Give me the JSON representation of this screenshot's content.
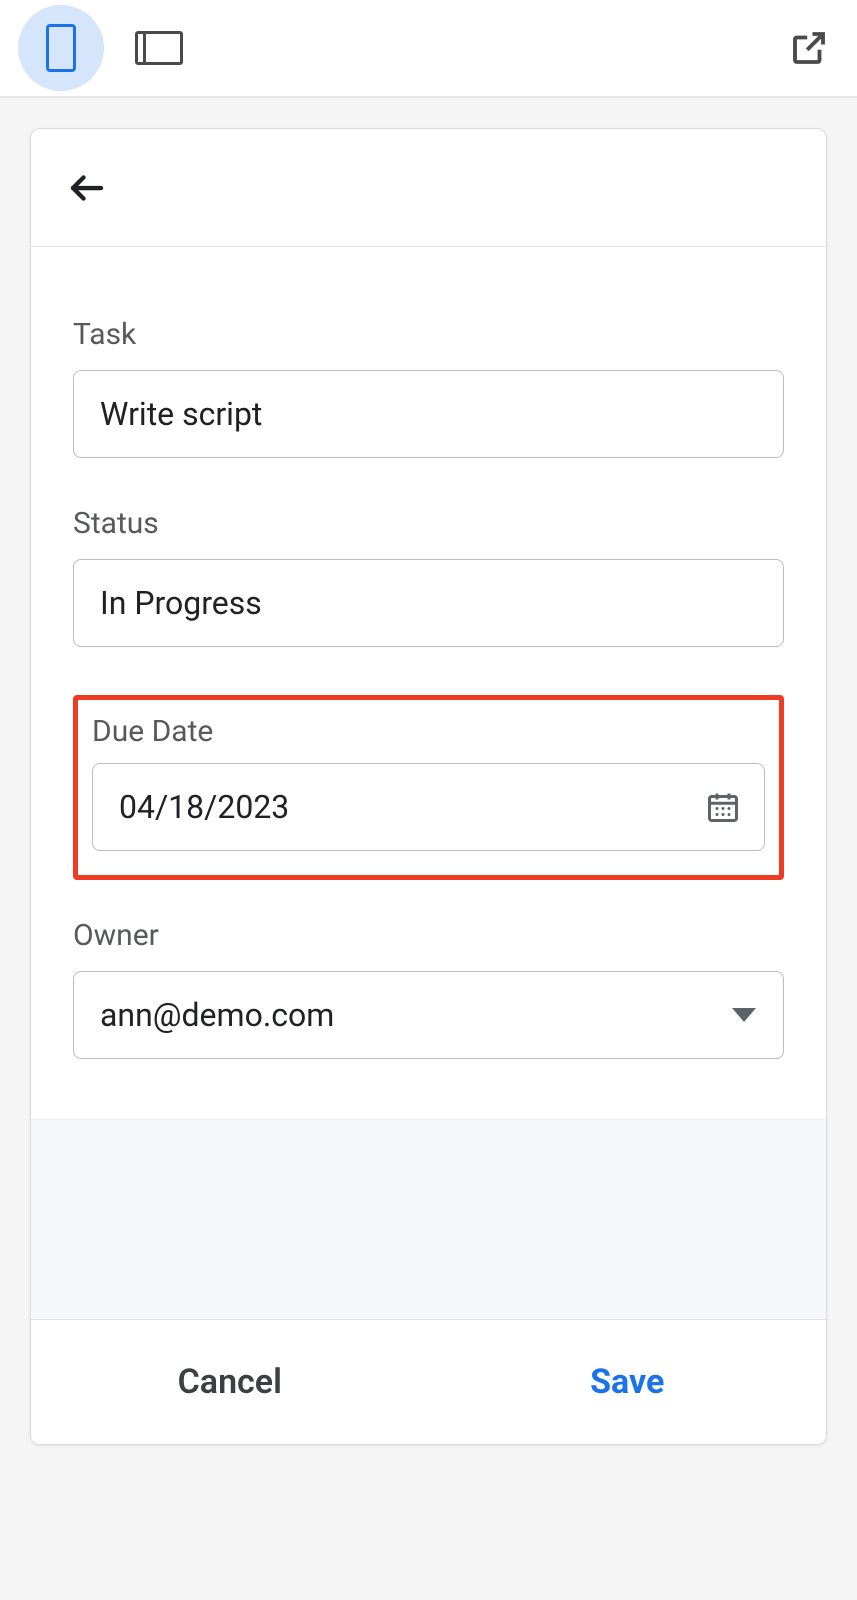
{
  "toolbar": {
    "mobile_view": "mobile",
    "tablet_view": "tablet",
    "open_external": "open"
  },
  "form": {
    "task": {
      "label": "Task",
      "value": "Write script"
    },
    "status": {
      "label": "Status",
      "value": "In Progress"
    },
    "due_date": {
      "label": "Due Date",
      "value": "04/18/2023"
    },
    "owner": {
      "label": "Owner",
      "value": "ann@demo.com"
    }
  },
  "actions": {
    "cancel": "Cancel",
    "save": "Save"
  }
}
